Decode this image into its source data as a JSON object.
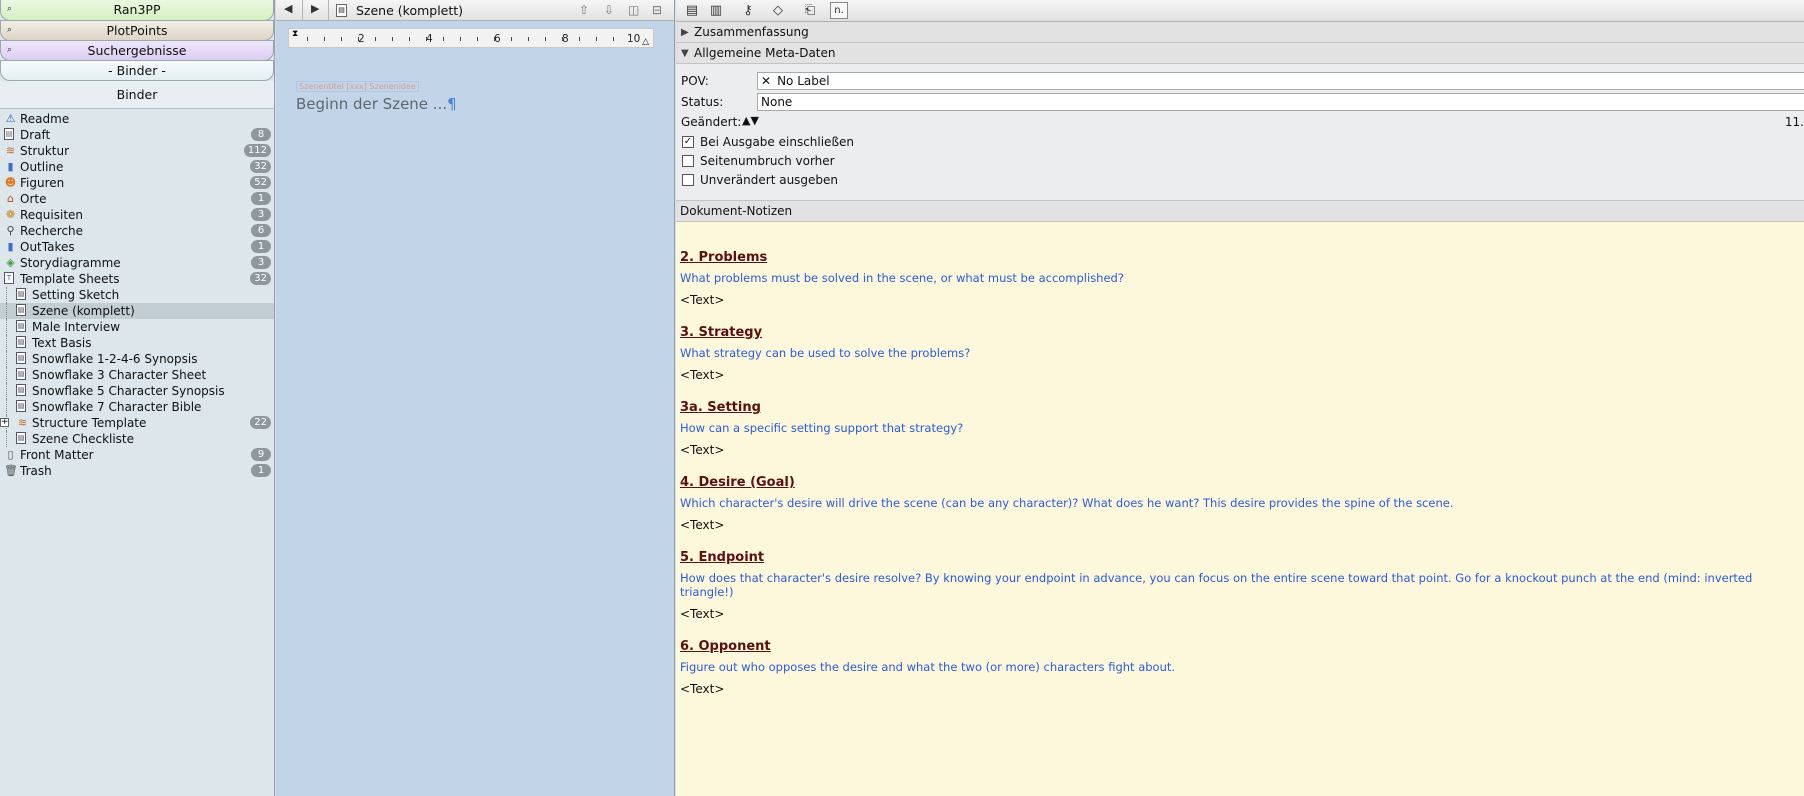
{
  "collections": [
    "Ran3PP",
    "PlotPoints",
    "Suchergebnisse",
    "- Binder -"
  ],
  "binder_header": "Binder",
  "binder": [
    {
      "label": "Readme",
      "count": "",
      "level": 0,
      "icon": "warning-icon"
    },
    {
      "label": "Draft",
      "count": "8",
      "level": 0,
      "icon": "draft-icon"
    },
    {
      "label": "Struktur",
      "count": "112",
      "level": 0,
      "icon": "structure-icon"
    },
    {
      "label": "Outline",
      "count": "32",
      "level": 0,
      "icon": "outline-icon"
    },
    {
      "label": "Figuren",
      "count": "52",
      "level": 0,
      "icon": "characters-icon"
    },
    {
      "label": "Orte",
      "count": "1",
      "level": 0,
      "icon": "places-icon"
    },
    {
      "label": "Requisiten",
      "count": "3",
      "level": 0,
      "icon": "props-icon"
    },
    {
      "label": "Recherche",
      "count": "6",
      "level": 0,
      "icon": "research-icon"
    },
    {
      "label": "OutTakes",
      "count": "1",
      "level": 0,
      "icon": "outtakes-icon"
    },
    {
      "label": "Storydiagramme",
      "count": "3",
      "level": 0,
      "icon": "diagram-icon"
    },
    {
      "label": "Template Sheets",
      "count": "32",
      "level": 0,
      "icon": "template-folder-icon"
    },
    {
      "label": "Setting Sketch",
      "count": "",
      "level": 1,
      "icon": "template-doc-icon"
    },
    {
      "label": "Szene (komplett)",
      "count": "",
      "level": 1,
      "icon": "template-doc-icon",
      "selected": true
    },
    {
      "label": "Male Interview",
      "count": "",
      "level": 1,
      "icon": "template-doc-icon"
    },
    {
      "label": "Text Basis",
      "count": "",
      "level": 1,
      "icon": "template-doc-icon"
    },
    {
      "label": "Snowflake 1-2-4-6 Synopsis",
      "count": "",
      "level": 1,
      "icon": "template-doc-icon"
    },
    {
      "label": "Snowflake 3 Character Sheet",
      "count": "",
      "level": 1,
      "icon": "template-doc-icon"
    },
    {
      "label": "Snowflake 5 Character Synopsis",
      "count": "",
      "level": 1,
      "icon": "template-doc-icon"
    },
    {
      "label": "Snowflake 7 Character Bible",
      "count": "",
      "level": 1,
      "icon": "template-doc-icon"
    },
    {
      "label": "Structure Template",
      "count": "22",
      "level": 1,
      "icon": "structure-icon",
      "expandable": true
    },
    {
      "label": "Szene Checkliste",
      "count": "",
      "level": 1,
      "icon": "template-doc-icon"
    },
    {
      "label": "Front Matter",
      "count": "9",
      "level": 0,
      "icon": "front-matter-icon"
    },
    {
      "label": "Trash",
      "count": "1",
      "level": 0,
      "icon": "trash-icon"
    }
  ],
  "editor": {
    "title": "Szene (komplett)",
    "ruler_numbers": [
      "2",
      "4",
      "6",
      "8",
      "10"
    ],
    "placeholder": "Szenentitel [xxx] Szenenidee",
    "body_text": "Beginn der Szene ...",
    "pilcrow": "¶"
  },
  "inspector": {
    "summary_label": "Zusammenfassung",
    "meta_label": "Allgemeine Meta-Daten",
    "pov_label": "POV:",
    "pov_value": "No Label",
    "status_label": "Status:",
    "status_value": "None",
    "modified_label": "Geändert:",
    "modified_value": "11.",
    "checkboxes": [
      {
        "label": "Bei Ausgabe einschließen",
        "checked": true
      },
      {
        "label": "Seitenumbruch vorher",
        "checked": false
      },
      {
        "label": "Unverändert ausgeben",
        "checked": false
      }
    ],
    "notes_label": "Dokument-Notizen",
    "notes": [
      {
        "heading": "2. Problems",
        "question": "What problems must be solved in the scene, or what must be accomplished?",
        "text": "<Text>"
      },
      {
        "heading": "3. Strategy",
        "question": "What strategy can be used to solve the problems?",
        "text": "<Text>"
      },
      {
        "heading": "3a. Setting",
        "question": "How can a specific setting support that strategy?",
        "text": "<Text>"
      },
      {
        "heading": "4. Desire (Goal)",
        "question": "Which character's desire will drive the scene (can be any character)? What does he want? This desire provides the spine of the scene.",
        "text": "<Text>"
      },
      {
        "heading": "5. Endpoint",
        "question": "How does that character's desire resolve? By knowing your endpoint in advance, you can focus on the entire scene toward that point. Go for a knockout punch at the end (mind: inverted triangle!)",
        "text": "<Text>"
      },
      {
        "heading": "6. Opponent",
        "question": "Figure out who opposes the desire and what the two (or more) characters fight about.",
        "text": "<Text>"
      }
    ]
  },
  "toolbar_icons": [
    "notes-icon",
    "bookmarks-icon",
    "keywords-icon",
    "tags-icon",
    "snapshots-icon",
    "comments-icon"
  ]
}
